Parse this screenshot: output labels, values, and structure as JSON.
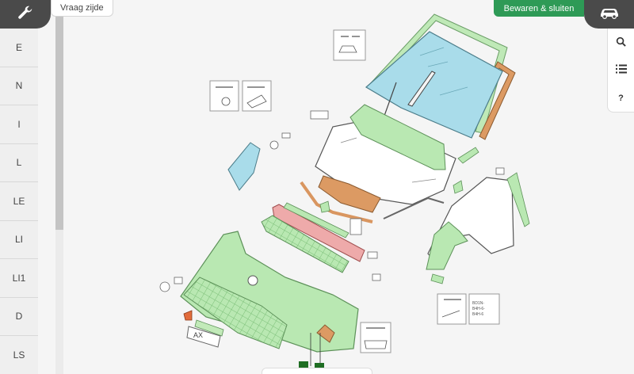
{
  "toolbar": {
    "tool_icon": "wrench-icon",
    "side_tab_label": "Vraag zijde",
    "save_close_label": "Bewaren & sluiten",
    "car_icon": "car-icon",
    "right_tools": [
      {
        "icon": "search-icon",
        "glyph": ""
      },
      {
        "icon": "list-icon",
        "glyph": ""
      },
      {
        "icon": "help-icon",
        "glyph": "?"
      }
    ]
  },
  "sidebar": {
    "items": [
      {
        "label": "E"
      },
      {
        "label": "N"
      },
      {
        "label": "I"
      },
      {
        "label": "L"
      },
      {
        "label": "LE"
      },
      {
        "label": "LI"
      },
      {
        "label": "LI1"
      },
      {
        "label": "D"
      },
      {
        "label": "LS"
      }
    ]
  },
  "colors": {
    "dark": "#4a4a4a",
    "accent_green": "#2e9a56",
    "part_green": "#b6e8b0",
    "part_blue": "#a9dcea",
    "part_orange": "#d99660",
    "part_red": "#eeaaaa"
  },
  "diagram": {
    "plate_text": "AX",
    "bracket_label": "BD1N-\nB4H-6-\nB4H-6"
  }
}
